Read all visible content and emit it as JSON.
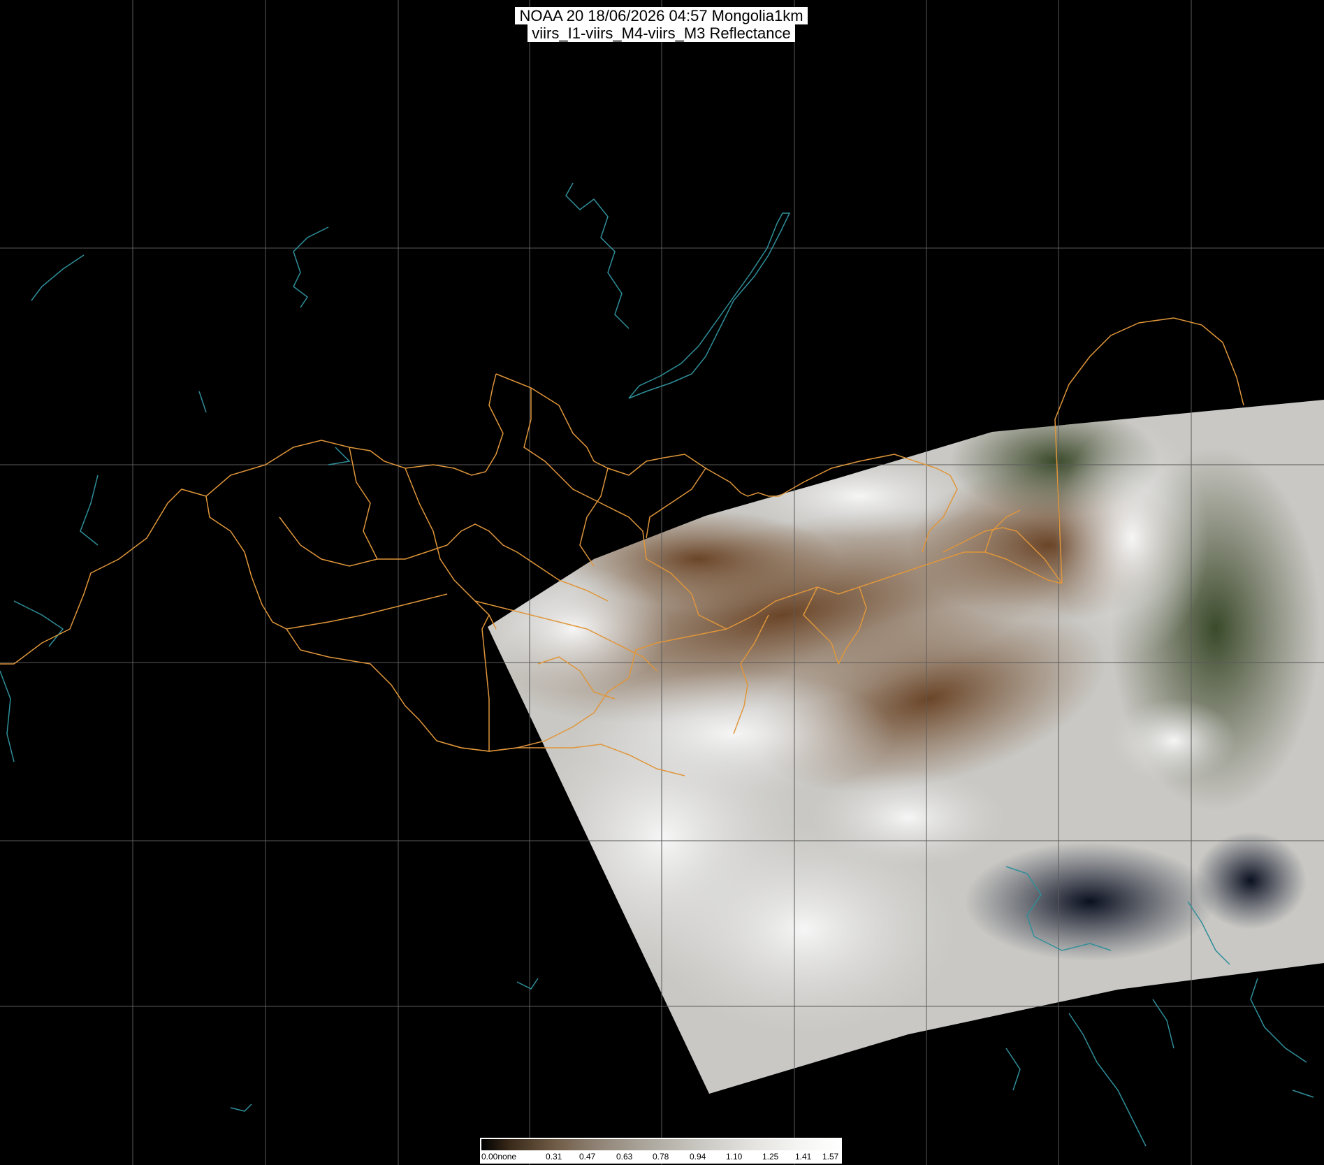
{
  "title": {
    "line1": "NOAA 20 18/06/2026 04:57 Mongolia1km",
    "line2": "viirs_I1-viirs_M4-viirs_M3 Reflectance"
  },
  "colors": {
    "background": "#000000",
    "graticule": "#5a5a5a",
    "borders": "#e0963a",
    "coastline": "#2f8f9a",
    "clouds": "#e8e8e8",
    "land": "#6b4a2e"
  },
  "colorbar": {
    "labels": [
      "0.00none",
      "0.31",
      "0.47",
      "0.63",
      "0.78",
      "0.94",
      "1.10",
      "1.25",
      "1.41",
      "1.57"
    ]
  }
}
